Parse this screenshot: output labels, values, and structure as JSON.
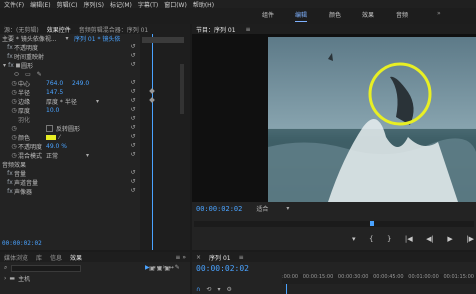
{
  "app": {
    "menu": [
      "文件(F)",
      "编辑(E)",
      "剪辑(C)",
      "序列(S)",
      "标记(M)",
      "字幕(T)",
      "窗口(W)",
      "帮助(H)"
    ],
    "workspaces": [
      "组件",
      "编辑",
      "颜色",
      "效果",
      "音频"
    ],
    "active_workspace": "编辑"
  },
  "left_panel": {
    "tabs": [
      "源：(无剪辑)",
      "效果控件",
      "音频剪辑混合器：序列 01"
    ],
    "active_tab": "效果控件",
    "clip_selector": "主要 * 镜头依像视...",
    "sequence_selector": "序列 01 * 镜头依",
    "sections": {
      "opacity_label": "不透明度",
      "time_remap": "时间重映射",
      "circle_label": "圆形",
      "center_label": "中心",
      "center_x": "764.0",
      "center_y": "249.0",
      "radius_label": "半径",
      "radius_val": "147.5",
      "edge_label": "边缘",
      "edge_val": "厚度 * 半径",
      "thickness_label": "厚度",
      "thickness_val": "10.0",
      "feather_label": "羽化",
      "invert_circle": "反转圆形",
      "color_label": "颜色",
      "opacity2_label": "不透明度",
      "opacity2_val": "49.0 %",
      "blend_label": "混合模式",
      "blend_val": "正常",
      "audio_effects": "音频效果",
      "volume": "音量",
      "channel_volume": "声道音量",
      "panner": "声像器"
    },
    "timecode": "00:00:02:02",
    "accent_yellow": "#e8ef24"
  },
  "bottom_left": {
    "tabs": [
      "媒体浏览",
      "库",
      "信息",
      "效果"
    ],
    "active_tab": "效果",
    "search_placeholder": "",
    "tree_item": "主机"
  },
  "program": {
    "title": "节目：序列 01",
    "timecode": "00:00:02:02",
    "fit": "适合",
    "overlay_color": "#e8ef24"
  },
  "timeline": {
    "title": "序列 01",
    "timecode": "00:00:02:02",
    "ruler": [
      ":00:00",
      "00:00:15:00",
      "00:00:30:00",
      "00:00:45:00",
      "00:01:00:00",
      "00:01:15:00"
    ]
  }
}
